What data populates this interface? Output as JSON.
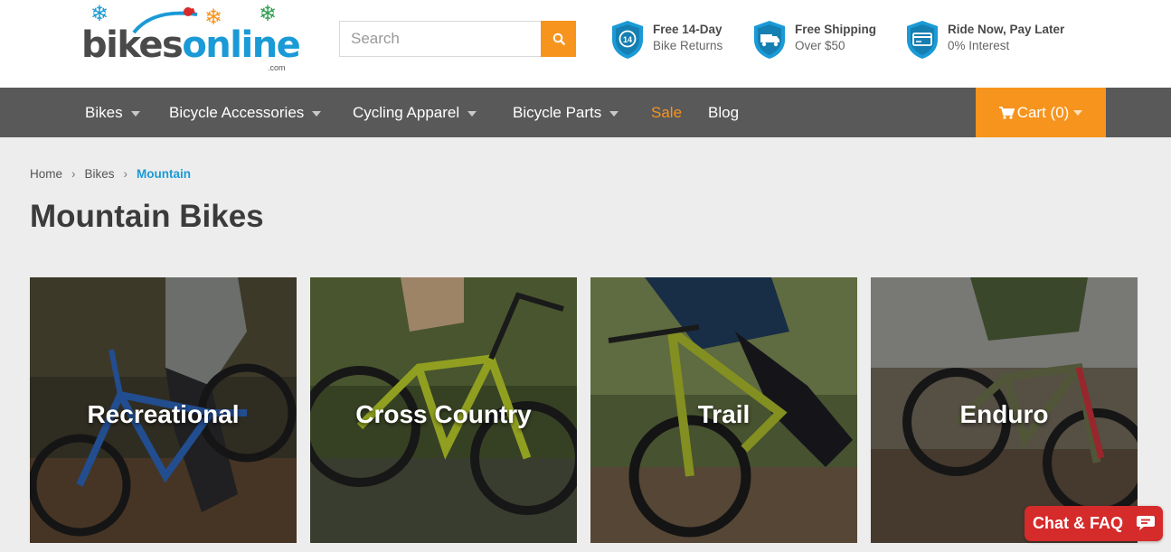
{
  "header": {
    "logo": {
      "text_main": "bikes",
      "text_accent": "online",
      "text_suffix": ".com",
      "icon": "snowflake-icon"
    },
    "search": {
      "placeholder": "Search",
      "value": "",
      "button_icon": "search-icon"
    },
    "perks": [
      {
        "title": "Free 14-Day",
        "subtitle": "Bike Returns",
        "icon": "returns-14-icon"
      },
      {
        "title": "Free Shipping",
        "subtitle": "Over $50",
        "icon": "delivery-truck-icon"
      },
      {
        "title": "Ride Now, Pay Later",
        "subtitle": "0% Interest",
        "icon": "credit-card-icon"
      }
    ]
  },
  "nav": {
    "items": [
      {
        "label": "Bikes",
        "has_dropdown": true
      },
      {
        "label": "Bicycle Accessories",
        "has_dropdown": true
      },
      {
        "label": "Cycling Apparel",
        "has_dropdown": true
      },
      {
        "label": "Bicycle Parts",
        "has_dropdown": true
      },
      {
        "label": "Sale",
        "has_dropdown": false
      },
      {
        "label": "Blog",
        "has_dropdown": false
      }
    ],
    "cart": {
      "label": "Cart (0)",
      "icon": "shopping-cart-icon"
    }
  },
  "breadcrumb": {
    "items": [
      "Home",
      "Bikes"
    ],
    "current": "Mountain",
    "separator_icon": "chevron-right-icon"
  },
  "page": {
    "title": "Mountain Bikes"
  },
  "categories": [
    {
      "label": "Recreational"
    },
    {
      "label": "Cross Country"
    },
    {
      "label": "Trail"
    },
    {
      "label": "Enduro"
    }
  ],
  "chat": {
    "label": "Chat & FAQ",
    "icon": "chat-bubble-icon"
  },
  "colors": {
    "accent_orange": "#f7941d",
    "brand_blue": "#1a9ad6",
    "nav_bg": "#595959",
    "page_bg": "#ededed",
    "chat_red": "#d62b2b"
  }
}
